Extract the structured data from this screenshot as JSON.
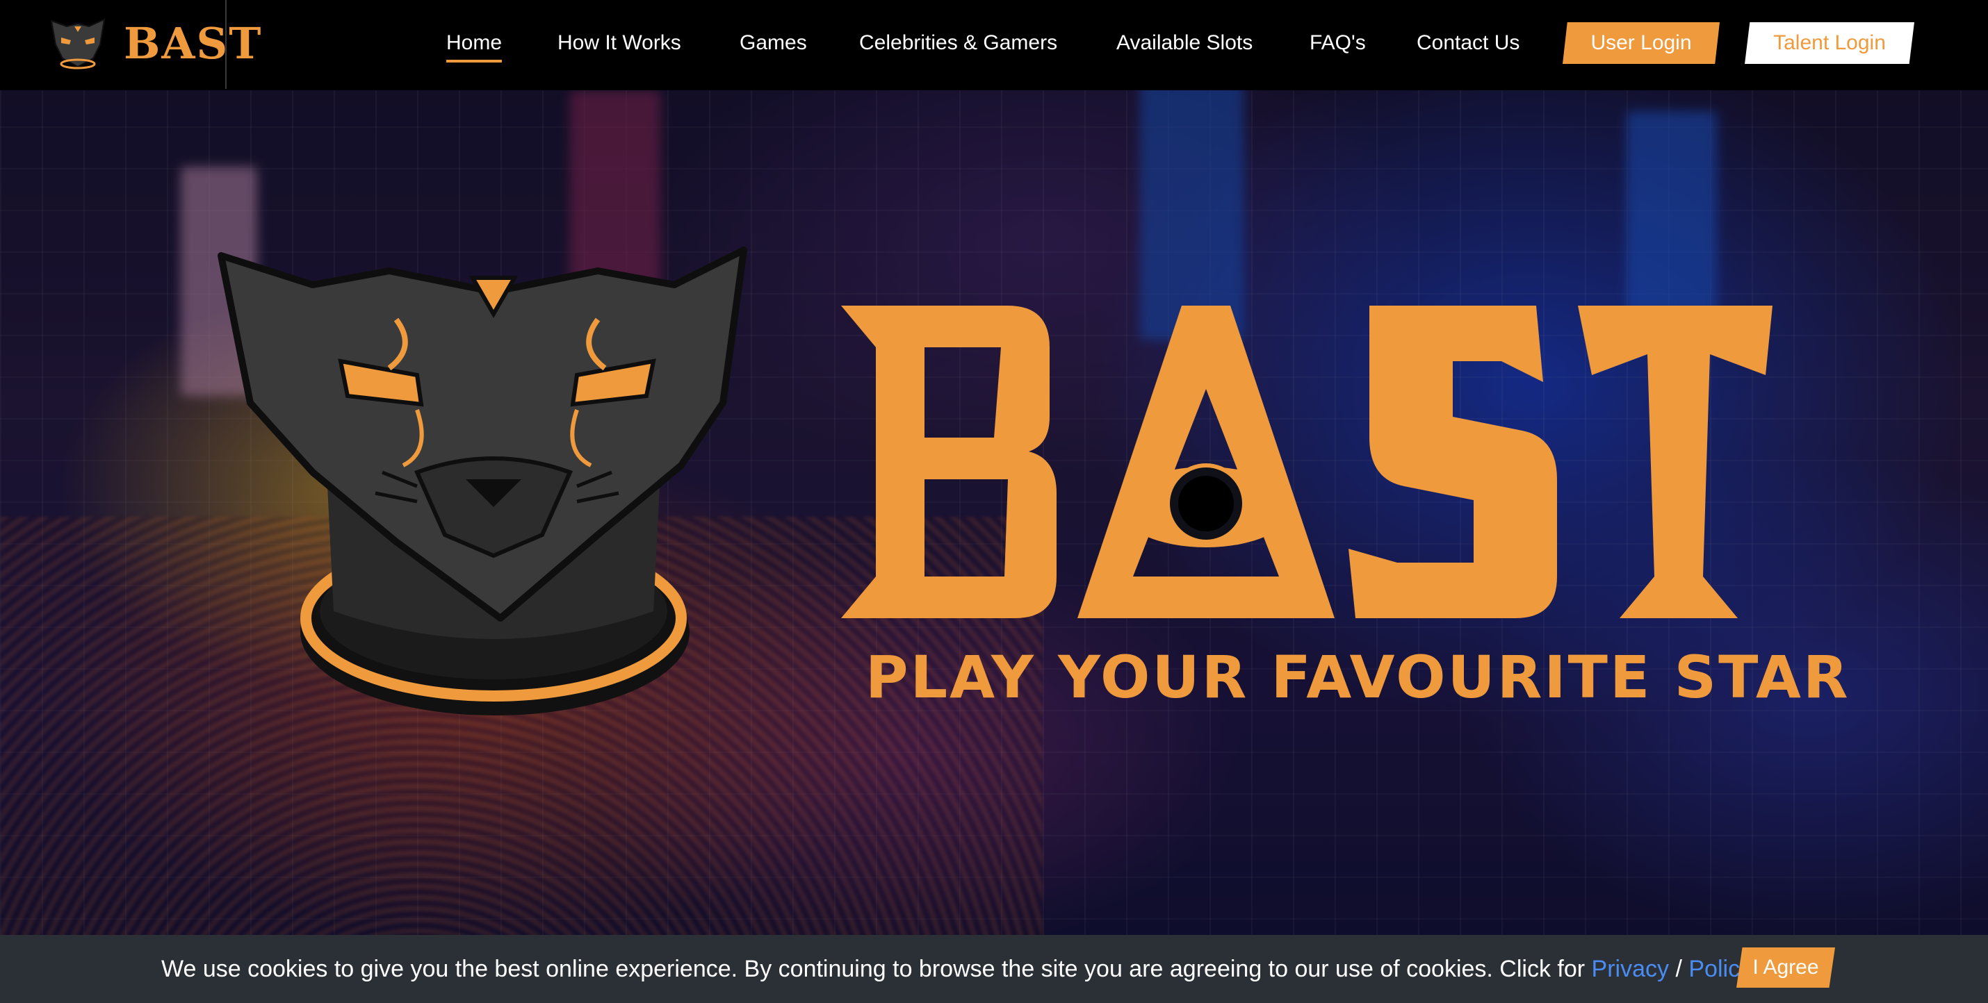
{
  "brand": {
    "name": "BAST",
    "tagline": "PLAY YOUR FAVOURITE STAR",
    "accent_color": "#ef9a3c"
  },
  "nav": {
    "items": [
      {
        "label": "Home",
        "active": true
      },
      {
        "label": "How It Works"
      },
      {
        "label": "Games"
      },
      {
        "label": "Celebrities & Gamers"
      },
      {
        "label": "Available Slots"
      },
      {
        "label": "FAQ's"
      },
      {
        "label": "Contact Us"
      }
    ],
    "user_login": "User Login",
    "talent_login": "Talent Login"
  },
  "icons": {
    "logo": "panther-head-icon",
    "hero_mascot": "panther-head-icon",
    "wordmark_eye": "all-seeing-eye-triangle-icon"
  },
  "cookie": {
    "text": "We use cookies to give you the best online experience. By continuing to browse the site you are agreeing to our use of cookies. Click for",
    "privacy": "Privacy",
    "separator": "/",
    "policy": "Policy",
    "agree": "I Agree"
  }
}
